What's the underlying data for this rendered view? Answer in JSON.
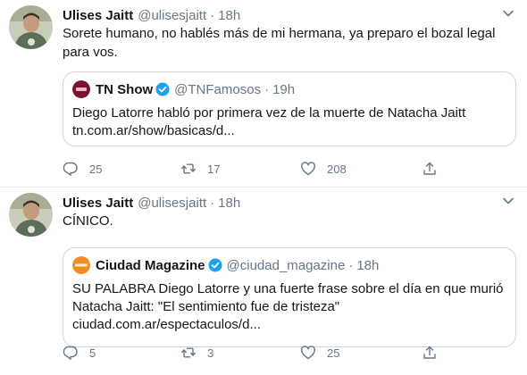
{
  "tweets": [
    {
      "author_name": "Ulises Jaitt",
      "author_handle": "@ulisesjaitt",
      "separator": "·",
      "time": "18h",
      "text": "Sorete humano, no hablés más de mi hermana, ya preparo el bozal legal para vos.",
      "quote": {
        "name": "TN Show",
        "handle": "@TNFamosos",
        "separator": "·",
        "time": "19h",
        "text_line1": "Diego Latorre habló por primera vez de la muerte de Natacha Jaitt",
        "text_line2": "tn.com.ar/show/basicas/d...",
        "text_line3": "",
        "avatar_color": "#7a1230",
        "verified_color": "#1da1f2"
      },
      "counts": {
        "replies": "25",
        "retweets": "17",
        "likes": "208"
      }
    },
    {
      "author_name": "Ulises Jaitt",
      "author_handle": "@ulisesjaitt",
      "separator": "·",
      "time": "18h",
      "text": "CÍNICO.",
      "quote": {
        "name": "Ciudad Magazine",
        "handle": "@ciudad_magazine",
        "separator": "·",
        "time": "18h",
        "text_line1": "SU PALABRA Diego Latorre y una fuerte frase sobre el día en que murió",
        "text_line2": "Natacha Jaitt: \"El sentimiento fue de tristeza\"",
        "text_line3": "ciudad.com.ar/espectaculos/d...",
        "avatar_color": "#f28c1e",
        "verified_color": "#1da1f2"
      },
      "counts": {
        "replies": "5",
        "retweets": "3",
        "likes": "25"
      }
    }
  ],
  "icons": {
    "reply": "reply-icon",
    "retweet": "retweet-icon",
    "like": "like-icon",
    "share": "share-icon",
    "caret": "chevron-down-icon",
    "verified": "verified-badge-icon"
  },
  "colors": {
    "text_primary": "#14171a",
    "text_secondary": "#657786",
    "border": "#ccd6dd",
    "divider": "#e6ecf0",
    "verified": "#1da1f2"
  }
}
